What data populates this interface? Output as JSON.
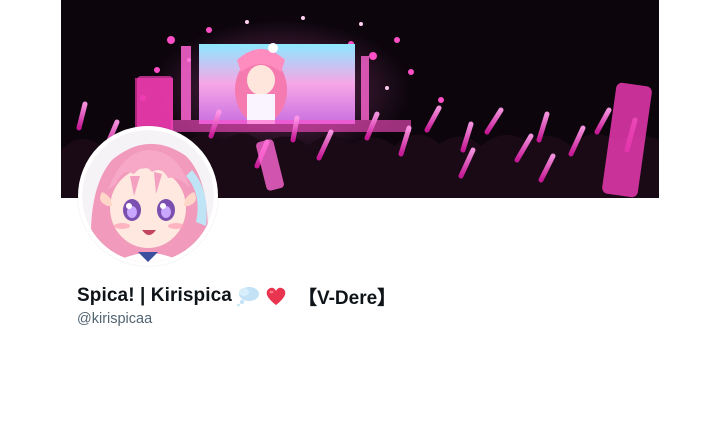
{
  "profile": {
    "display_name": "Spica! | Kirispica",
    "name_suffix": "【V-Dere】",
    "handle": "@kirispicaa"
  },
  "icons": {
    "banner": "concert-stage-banner-image",
    "avatar": "anime-girl-avatar-image",
    "emoji_1": "thought-bubble-icon",
    "emoji_2": "heart-icon"
  },
  "colors": {
    "name_text": "#0f1419",
    "handle_text": "#536471",
    "glow_pink": "#ff3fc8",
    "heart": "#e8344e",
    "bubble": "#bfdff5"
  }
}
